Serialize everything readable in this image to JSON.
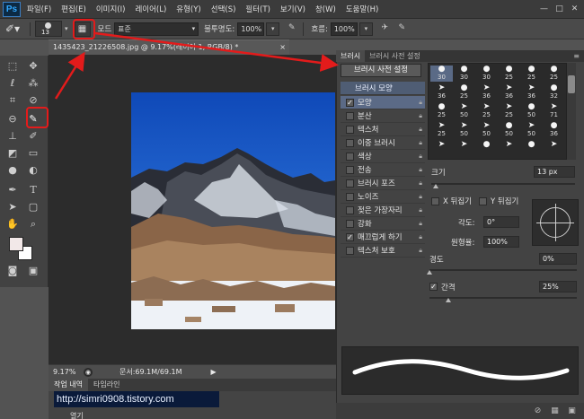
{
  "app": {
    "logo": "Ps"
  },
  "menu": [
    "파일(F)",
    "편집(E)",
    "이미지(I)",
    "레이어(L)",
    "유형(Y)",
    "선택(S)",
    "필터(T)",
    "보기(V)",
    "창(W)",
    "도움말(H)"
  ],
  "window_controls": [
    "—",
    "□",
    "✕"
  ],
  "options_bar": {
    "brush_size": "13",
    "mode_label": "모드",
    "mode_value": "표준",
    "opacity_label": "불투명도:",
    "opacity_value": "100%",
    "flow_label": "흐름:",
    "flow_value": "100%"
  },
  "document": {
    "tab_title": "1435423_21226508.jpg @ 9.17%(레이어 1, RGB/8) *",
    "close": "×",
    "zoom": "9.17%",
    "doc_info": "문서:69.1M/69.1M"
  },
  "bottom_panel": {
    "tabs": [
      "작업 내역",
      "타임라인"
    ],
    "url": "http://simri0908.tistory.com",
    "partial_label": "열기"
  },
  "brush_panel": {
    "tabs": [
      "브러시",
      "브러시 사전 설정"
    ],
    "presets_button": "브러시 사전 설정",
    "settings": [
      {
        "label": "브러시 모양",
        "checked": null
      },
      {
        "label": "모양",
        "checked": true
      },
      {
        "label": "분산",
        "checked": false
      },
      {
        "label": "텍스처",
        "checked": false
      },
      {
        "label": "이중 브러시",
        "checked": false
      },
      {
        "label": "색상",
        "checked": false
      },
      {
        "label": "전송",
        "checked": false
      },
      {
        "label": "브러시 포즈",
        "checked": false
      },
      {
        "label": "노이즈",
        "checked": false
      },
      {
        "label": "젖은 가장자리",
        "checked": false
      },
      {
        "label": "강화",
        "checked": false
      },
      {
        "label": "매끄럽게 하기",
        "checked": true
      },
      {
        "label": "텍스처 보호",
        "checked": false
      }
    ],
    "tip_sizes": [
      [
        "30",
        "30",
        "30",
        "25",
        "25",
        "25"
      ],
      [
        "36",
        "25",
        "36",
        "36",
        "36",
        "32"
      ],
      [
        "25",
        "50",
        "25",
        "25",
        "50",
        "71"
      ],
      [
        "25",
        "50",
        "50",
        "50",
        "50",
        "36"
      ],
      [
        "",
        "",
        "",
        "",
        "",
        ""
      ]
    ],
    "size_label": "크기",
    "size_value": "13 px",
    "flip_x": "X 뒤집기",
    "flip_y": "Y 뒤집기",
    "angle_label": "각도:",
    "angle_value": "0°",
    "roundness_label": "원형율:",
    "roundness_value": "100%",
    "hardness_label": "경도",
    "hardness_value": "0%",
    "spacing_label": "간격",
    "spacing_checked": true,
    "spacing_value": "25%"
  },
  "colors": {
    "highlight": "#e31b1b",
    "sky": "#1f5fc4"
  }
}
